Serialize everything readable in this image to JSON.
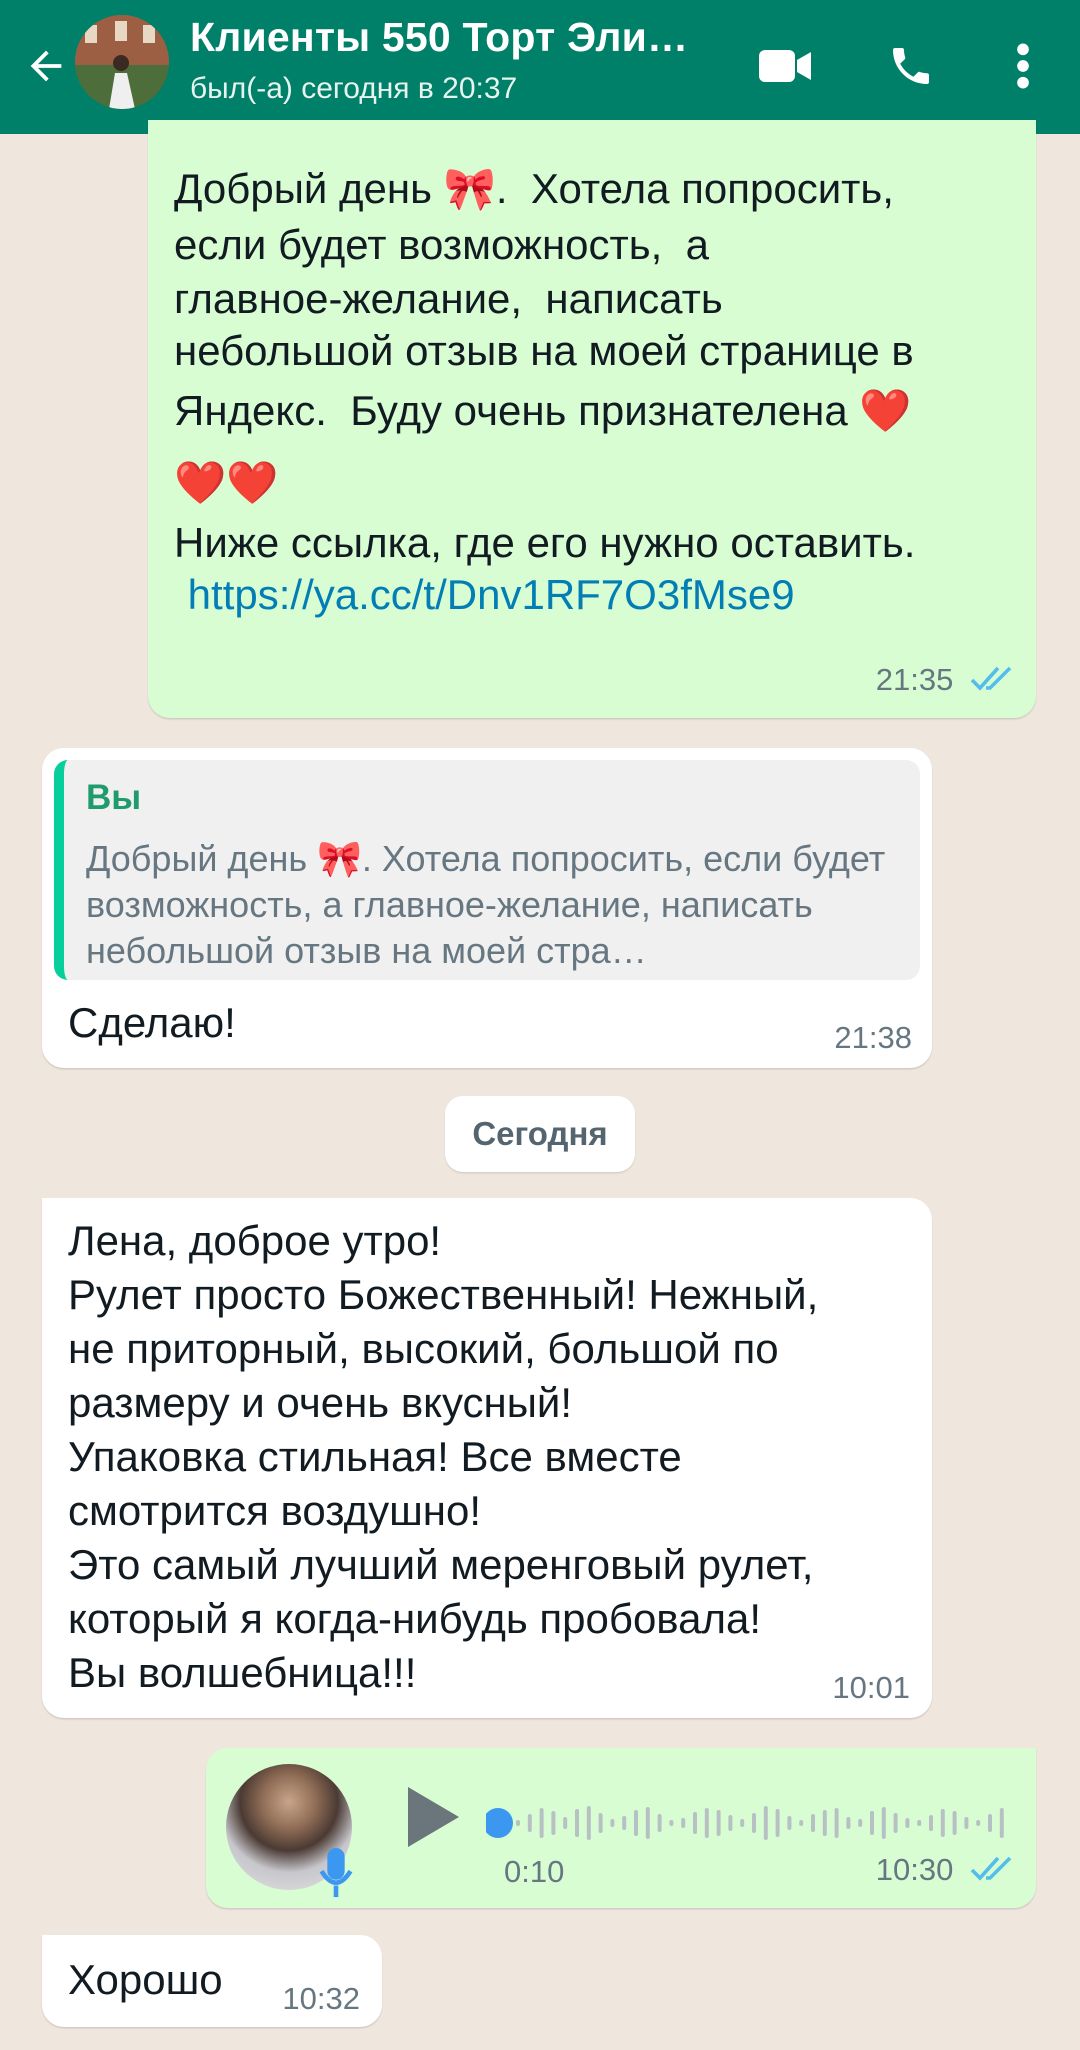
{
  "header": {
    "title": "Клиенты 550 Торт Эли…",
    "status": "был(-а) сегодня в 20:37"
  },
  "messages": {
    "m1": {
      "line1": "Добрый день 🎀.  Хотела попросить,",
      "line2": "если будет возможность,  а",
      "line3": "главное-желание,  написать",
      "line4": "небольшой отзыв на моей странице в",
      "line5": "Яндекс.  Буду очень признателена ❤️",
      "line6": "❤️❤️",
      "line7": "Ниже ссылка, где его нужно оставить.",
      "link": " https://ya.cc/t/Dnv1RF7O3fMse9",
      "time": "21:35"
    },
    "m2": {
      "quote_author": "Вы",
      "quote_text": "Добрый день 🎀.  Хотела попросить,  если будет возможность,  а главное-желание, написать небольшой отзыв на моей стра…",
      "text": "Сделаю!",
      "time": "21:38"
    },
    "date_chip": "Сегодня",
    "m3": {
      "text": "Лена, доброе утро!\nРулет просто Божественный! Нежный,\nне приторный, высокий, большой по\nразмеру и очень вкусный!\nУпаковка стильная! Все вместе\nсмотрится воздушно!\nЭто самый лучший меренговый рулет,\nкоторый я когда-нибудь пробовала!\nВы волшебница!!!",
      "time": "10:01"
    },
    "m4": {
      "duration": "0:10",
      "time": "10:30",
      "progress": 0
    },
    "m5": {
      "text": "Хорошо",
      "time": "10:32"
    }
  },
  "colors": {
    "header": "#008069",
    "outgoing_bubble": "#d9fdd3",
    "incoming_bubble": "#ffffff",
    "read_ticks": "#53bdeb",
    "link": "#027eb5"
  },
  "icons": [
    "back-arrow-icon",
    "video-call-icon",
    "phone-icon",
    "more-vert-icon",
    "play-icon",
    "mic-icon",
    "double-check-icon"
  ]
}
